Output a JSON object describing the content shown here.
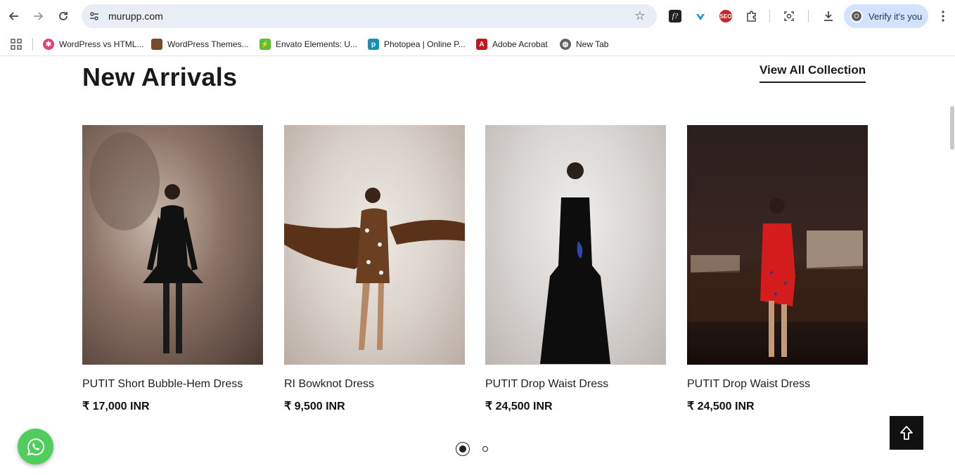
{
  "browser": {
    "url": "murupp.com",
    "profile_label": "Verify it's you",
    "profile_initial": "O",
    "bookmarks": [
      {
        "label": "WordPress vs HTML...",
        "color": "#e5416d"
      },
      {
        "label": "WordPress Themes...",
        "color": "#7a4b2a"
      },
      {
        "label": "Envato Elements: U...",
        "color": "#55c232"
      },
      {
        "label": "Photopea | Online P...",
        "color": "#1a8fb5"
      },
      {
        "label": "Adobe Acrobat",
        "color": "#c4161c"
      },
      {
        "label": "New Tab",
        "color": "#5f6368"
      }
    ]
  },
  "section": {
    "title": "New Arrivals",
    "view_all_label": "View All Collection"
  },
  "products": [
    {
      "name": "PUTIT Short Bubble-Hem Dress",
      "price": "₹ 17,000 INR"
    },
    {
      "name": "RI Bowknot Dress",
      "price": "₹ 9,500 INR"
    },
    {
      "name": "PUTIT Drop Waist Dress",
      "price": "₹ 24,500 INR"
    },
    {
      "name": "PUTIT Drop Waist Dress",
      "price": "₹ 24,500 INR"
    }
  ],
  "carousel": {
    "current_page": 1,
    "total_pages": 2
  },
  "colors": {
    "whatsapp": "#4fce5d",
    "to_top": "#111111",
    "omnibox": "#e9eef6",
    "profile_chip": "#d3e3fd"
  }
}
